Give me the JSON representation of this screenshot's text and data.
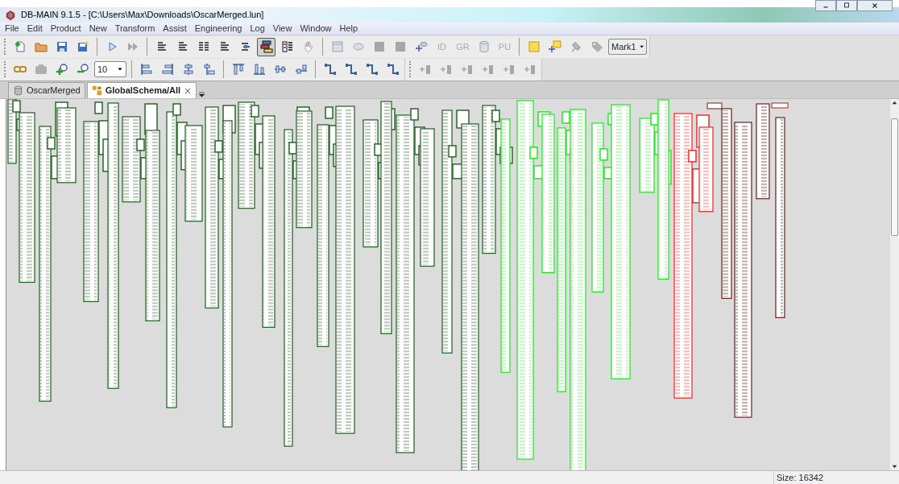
{
  "window": {
    "title": "DB-MAIN 9.1.5 - [C:\\Users\\Max\\Downloads\\OscarMerged.lun]"
  },
  "menu": [
    "File",
    "Edit",
    "Product",
    "New",
    "Transform",
    "Assist",
    "Engineering",
    "Log",
    "View",
    "Window",
    "Help"
  ],
  "toolbars": [
    [
      {
        "kind": "icon",
        "disabled": false,
        "pressed": false
      },
      {
        "kind": "icon",
        "disabled": false,
        "pressed": false
      },
      {
        "kind": "icon",
        "disabled": false,
        "pressed": false
      },
      {
        "kind": "icon",
        "disabled": false,
        "pressed": false
      },
      {
        "kind": "separator"
      },
      {
        "kind": "icon",
        "disabled": false,
        "pressed": false
      },
      {
        "kind": "icon",
        "disabled": true,
        "pressed": false
      },
      {
        "kind": "separator"
      },
      {
        "kind": "icon",
        "disabled": false,
        "pressed": false
      },
      {
        "kind": "icon",
        "disabled": false,
        "pressed": false
      },
      {
        "kind": "icon",
        "disabled": false,
        "pressed": false
      },
      {
        "kind": "icon",
        "disabled": false,
        "pressed": false
      },
      {
        "kind": "icon",
        "disabled": false,
        "pressed": false
      },
      {
        "kind": "icon",
        "disabled": false,
        "pressed": true
      },
      {
        "kind": "icon",
        "disabled": false,
        "pressed": false
      },
      {
        "kind": "icon",
        "disabled": true,
        "pressed": false
      },
      {
        "kind": "separator"
      },
      {
        "kind": "icon",
        "disabled": true,
        "pressed": false
      },
      {
        "kind": "icon",
        "disabled": true,
        "pressed": false
      },
      {
        "kind": "icon",
        "disabled": true,
        "pressed": false
      },
      {
        "kind": "icon",
        "disabled": true,
        "pressed": false
      },
      {
        "kind": "icon",
        "disabled": false,
        "pressed": false
      },
      {
        "kind": "label",
        "text": "ID",
        "disabled": true
      },
      {
        "kind": "label",
        "text": "GR",
        "disabled": true
      },
      {
        "kind": "icon",
        "disabled": true,
        "pressed": false
      },
      {
        "kind": "label",
        "text": "PU",
        "disabled": true
      },
      {
        "kind": "separator"
      },
      {
        "kind": "icon",
        "disabled": false,
        "pressed": false
      },
      {
        "kind": "icon",
        "disabled": false,
        "pressed": false
      },
      {
        "kind": "icon",
        "disabled": true,
        "pressed": false
      },
      {
        "kind": "icon",
        "disabled": true,
        "pressed": false
      },
      {
        "kind": "combo",
        "value": "Mark1"
      }
    ],
    [
      {
        "kind": "icon",
        "disabled": false,
        "pressed": false
      },
      {
        "kind": "icon",
        "disabled": true,
        "pressed": false
      },
      {
        "kind": "icon",
        "disabled": false,
        "pressed": false
      },
      {
        "kind": "icon",
        "disabled": false,
        "pressed": false
      },
      {
        "kind": "combo",
        "value": "10"
      },
      {
        "kind": "separator"
      },
      {
        "kind": "icon",
        "disabled": false,
        "pressed": false
      },
      {
        "kind": "icon",
        "disabled": false,
        "pressed": false
      },
      {
        "kind": "icon",
        "disabled": false,
        "pressed": false
      },
      {
        "kind": "icon",
        "disabled": false,
        "pressed": false
      },
      {
        "kind": "separator"
      },
      {
        "kind": "icon",
        "disabled": false,
        "pressed": false
      },
      {
        "kind": "icon",
        "disabled": false,
        "pressed": false
      },
      {
        "kind": "icon",
        "disabled": false,
        "pressed": false
      },
      {
        "kind": "icon",
        "disabled": false,
        "pressed": false
      },
      {
        "kind": "separator"
      },
      {
        "kind": "icon",
        "disabled": false,
        "pressed": false
      },
      {
        "kind": "icon",
        "disabled": false,
        "pressed": false
      },
      {
        "kind": "icon",
        "disabled": false,
        "pressed": false
      },
      {
        "kind": "icon",
        "disabled": false,
        "pressed": false
      },
      {
        "kind": "grip"
      },
      {
        "kind": "icon",
        "disabled": true,
        "pressed": false
      },
      {
        "kind": "icon",
        "disabled": true,
        "pressed": false
      },
      {
        "kind": "icon",
        "disabled": true,
        "pressed": false
      },
      {
        "kind": "icon",
        "disabled": true,
        "pressed": false
      },
      {
        "kind": "icon",
        "disabled": true,
        "pressed": false
      },
      {
        "kind": "icon",
        "disabled": true,
        "pressed": false
      }
    ]
  ],
  "tabs": [
    {
      "label": "OscarMerged",
      "selected": false,
      "closable": false
    },
    {
      "label": "GlobalSchema/All",
      "selected": true,
      "closable": true
    }
  ],
  "status_bar": {
    "size": "Size: 16342"
  }
}
